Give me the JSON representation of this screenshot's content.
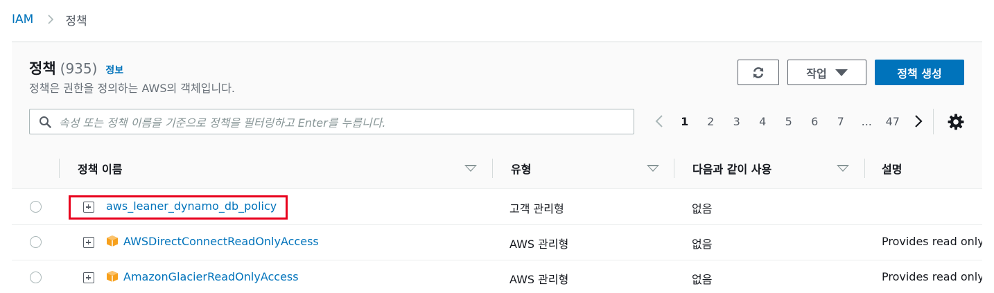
{
  "breadcrumb": {
    "root": "IAM",
    "current": "정책"
  },
  "header": {
    "title": "정책",
    "count": "(935)",
    "info_link": "정보",
    "subtitle": "정책은 권한을 정의하는 AWS의 객체입니다.",
    "actions_label": "작업",
    "create_label": "정책 생성"
  },
  "search": {
    "placeholder": "속성 또는 정책 이름을 기준으로 정책을 필터링하고 Enter를 누릅니다."
  },
  "pagination": {
    "pages": [
      "1",
      "2",
      "3",
      "4",
      "5",
      "6",
      "7",
      "...",
      "47"
    ],
    "current": "1"
  },
  "columns": [
    "정책 이름",
    "유형",
    "다음과 같이 사용",
    "설명"
  ],
  "rows": [
    {
      "name": "aws_leaner_dynamo_db_policy",
      "type": "고객 관리형",
      "used_as": "없음",
      "description": "",
      "aws_managed": false,
      "highlighted": true
    },
    {
      "name": "AWSDirectConnectReadOnlyAccess",
      "type": "AWS 관리형",
      "used_as": "없음",
      "description": "Provides read only",
      "aws_managed": true,
      "highlighted": false
    },
    {
      "name": "AmazonGlacierReadOnlyAccess",
      "type": "AWS 관리형",
      "used_as": "없음",
      "description": "Provides read only",
      "aws_managed": true,
      "highlighted": false
    }
  ],
  "colors": {
    "link": "#0073bb",
    "primary_button": "#0073bb",
    "highlight_box": "#e8001c",
    "aws_icon": "#f7a01c"
  },
  "icons": [
    "chevron-right-icon",
    "refresh-icon",
    "caret-down-icon",
    "search-icon",
    "chevron-left-icon",
    "gear-icon",
    "expand-icon",
    "aws-cube-icon",
    "sort-icon"
  ]
}
